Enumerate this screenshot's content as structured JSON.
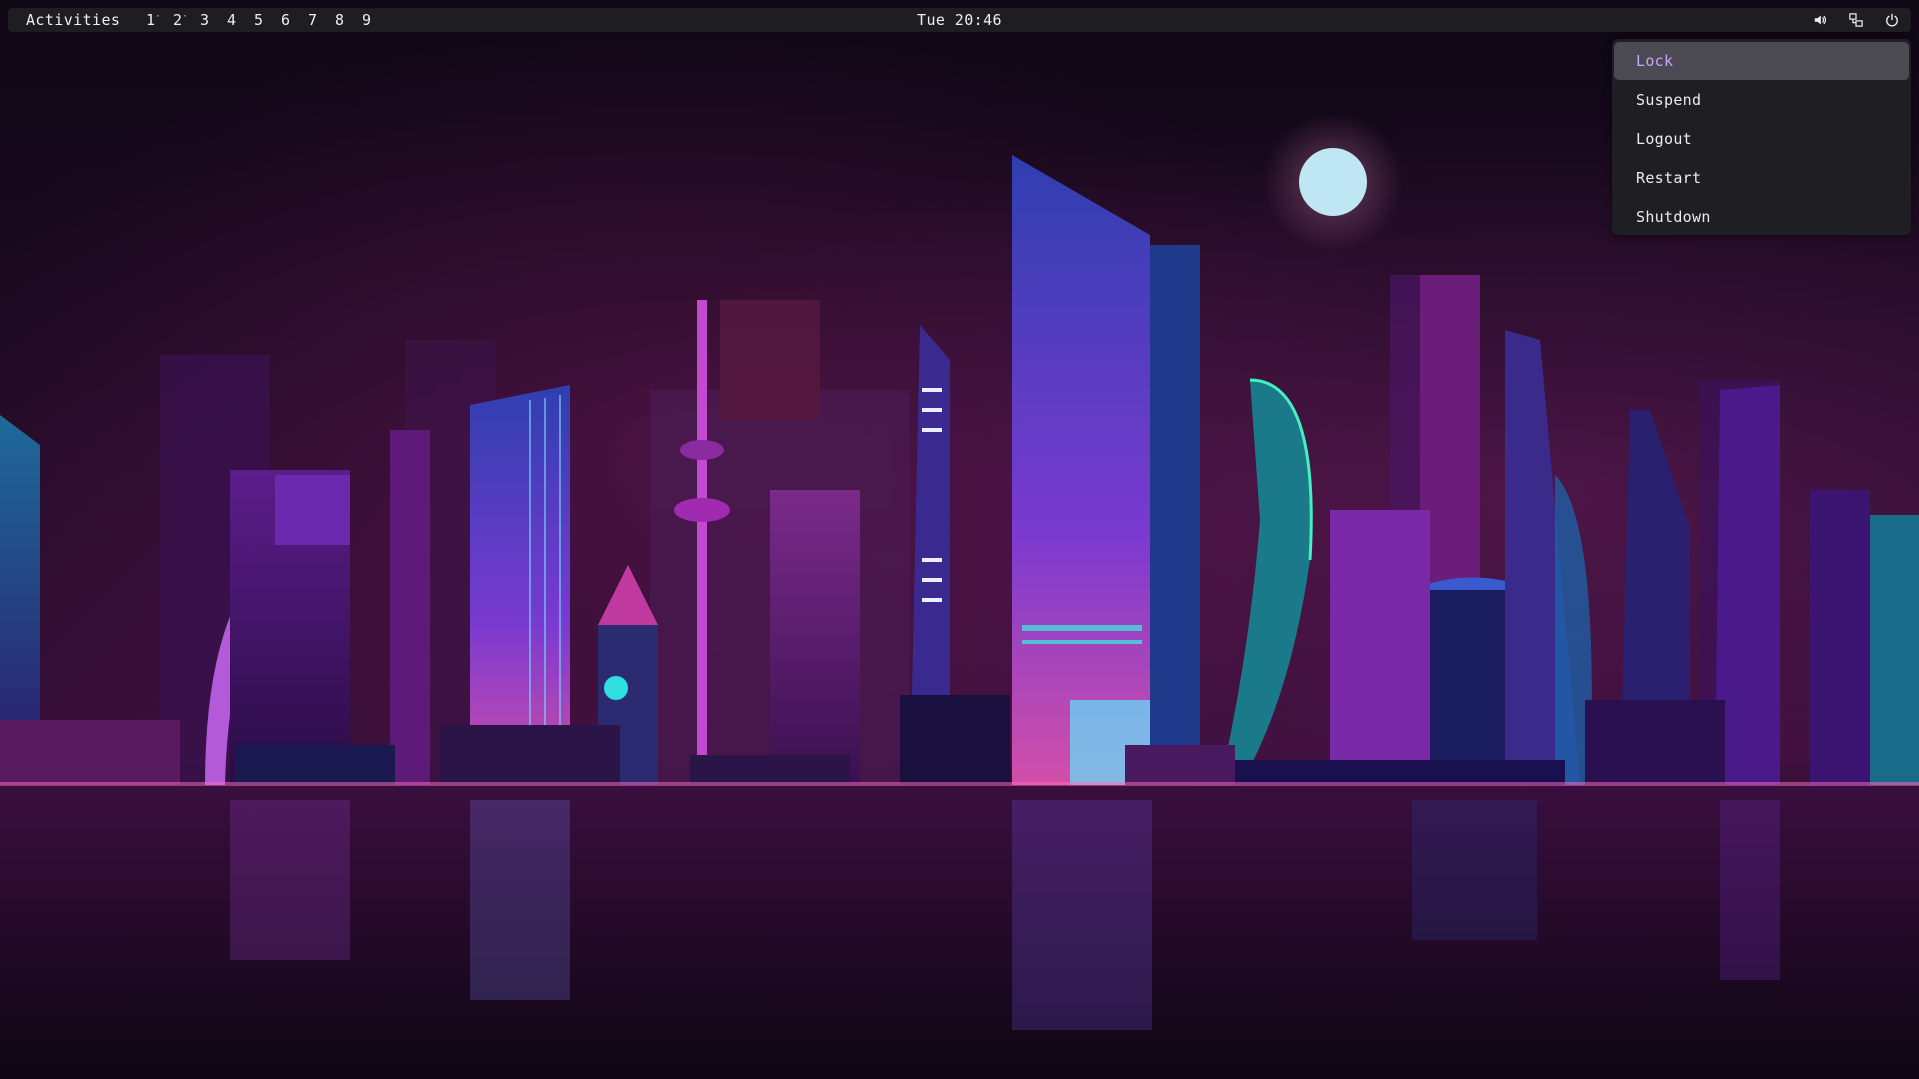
{
  "topbar": {
    "activities_label": "Activities",
    "workspaces": [
      {
        "label": "1",
        "occupied": true
      },
      {
        "label": "2",
        "occupied": true
      },
      {
        "label": "3",
        "occupied": false
      },
      {
        "label": "4",
        "occupied": false
      },
      {
        "label": "5",
        "occupied": false
      },
      {
        "label": "6",
        "occupied": false
      },
      {
        "label": "7",
        "occupied": false
      },
      {
        "label": "8",
        "occupied": false
      },
      {
        "label": "9",
        "occupied": false
      }
    ],
    "occupied_marker": "·",
    "clock": "Tue 20:46",
    "tray": [
      {
        "icon": "speaker-icon"
      },
      {
        "icon": "network-icon"
      },
      {
        "icon": "power-icon"
      }
    ]
  },
  "power_menu": {
    "items": [
      {
        "label": "Lock",
        "active": true
      },
      {
        "label": "Suspend",
        "active": false
      },
      {
        "label": "Logout",
        "active": false
      },
      {
        "label": "Restart",
        "active": false
      },
      {
        "label": "Shutdown",
        "active": false
      }
    ]
  },
  "colors": {
    "topbar_bg": "#1e1e22",
    "menu_bg": "#1f1f23",
    "menu_highlight_bg": "#4b4a52",
    "menu_highlight_text": "#c7a6ff"
  }
}
